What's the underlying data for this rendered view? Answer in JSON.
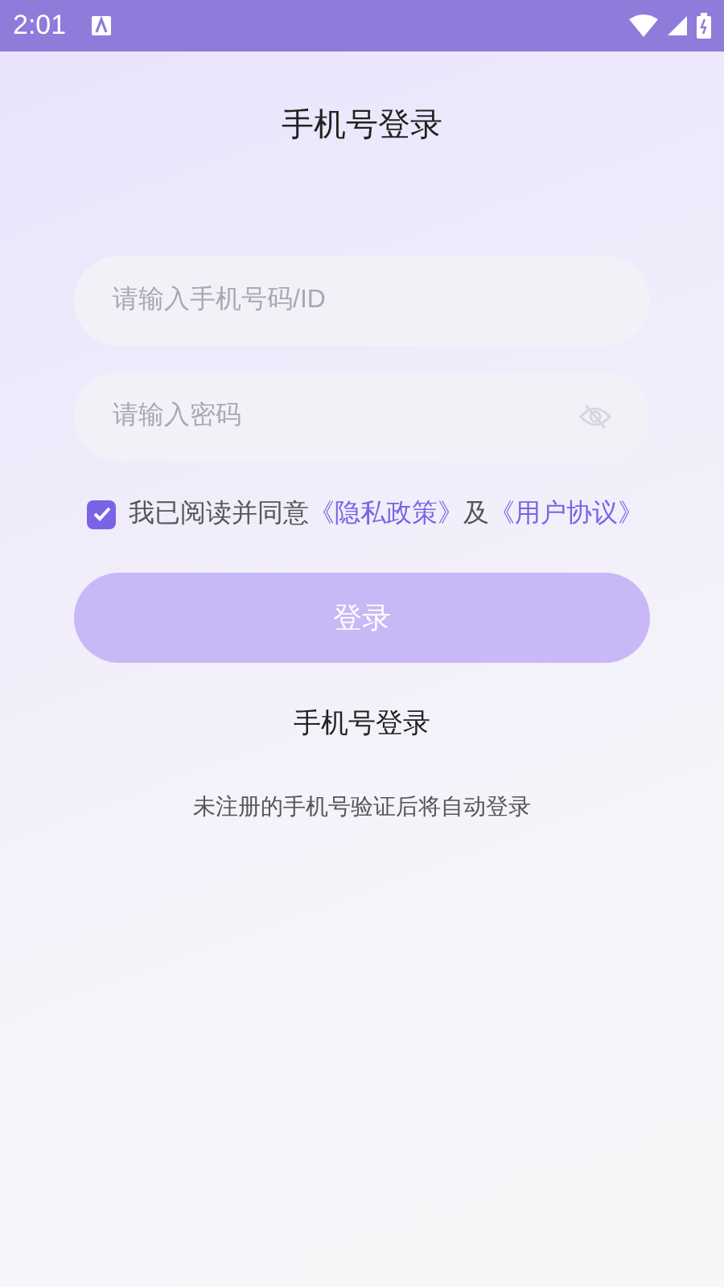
{
  "status_bar": {
    "time": "2:01"
  },
  "title": "手机号登录",
  "fields": [
    {
      "placeholder": "请输入手机号码/ID",
      "kind": "text"
    },
    {
      "placeholder": "请输入密码",
      "kind": "password"
    }
  ],
  "agreement": {
    "checked": true,
    "parts": [
      {
        "kind": "text",
        "text": "我已阅读并同意"
      },
      {
        "kind": "link",
        "text": "《隐私政策》"
      },
      {
        "kind": "text",
        "text": "及"
      },
      {
        "kind": "link",
        "text": "《用户协议》"
      }
    ]
  },
  "login_button": {
    "label": "登录",
    "disabled": true
  },
  "switch_link": "手机号登录",
  "note": "未注册的手机号验证后将自动登录"
}
